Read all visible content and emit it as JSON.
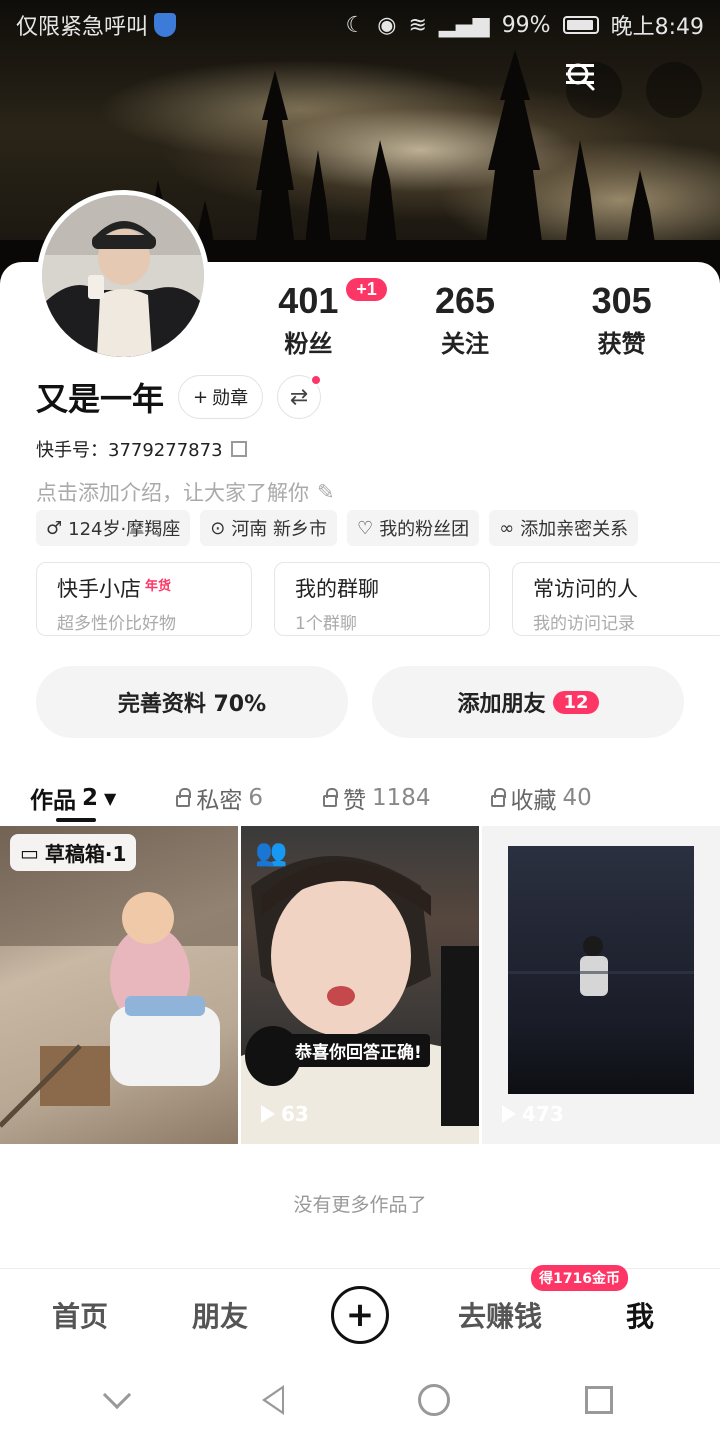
{
  "status_bar": {
    "left_text": "仅限紧急呼叫",
    "battery": "99%",
    "time": "晚上8:49"
  },
  "profile": {
    "stats": [
      {
        "value": "401",
        "label": "粉丝",
        "badge": "+1"
      },
      {
        "value": "265",
        "label": "关注"
      },
      {
        "value": "305",
        "label": "获赞"
      }
    ],
    "name": "又是一年",
    "medal_label": "勋章",
    "kwai_id": "快手号：3779277873",
    "bio_placeholder": "点击添加介绍，让大家了解你",
    "tags": [
      {
        "icon": "male-icon",
        "text": "124岁·摩羯座"
      },
      {
        "icon": "location-icon",
        "text": "河南 新乡市"
      },
      {
        "icon": "fan-club-icon",
        "text": "我的粉丝团"
      },
      {
        "icon": "intimate-icon",
        "text": "添加亲密关系"
      }
    ]
  },
  "features": [
    {
      "title": "快手小店",
      "badge": "年货",
      "subtitle": "超多性价比好物"
    },
    {
      "title": "我的群聊",
      "subtitle": "1个群聊"
    },
    {
      "title": "常访问的人",
      "subtitle": "我的访问记录"
    }
  ],
  "actions": {
    "complete_profile": "完善资料 70%",
    "add_friend": "添加朋友",
    "add_friend_count": "12"
  },
  "tabs": [
    {
      "label": "作品",
      "count": "2",
      "locked": false
    },
    {
      "label": "私密",
      "count": "6",
      "locked": true
    },
    {
      "label": "赞",
      "count": "1184",
      "locked": true
    },
    {
      "label": "收藏",
      "count": "40",
      "locked": true
    }
  ],
  "videos": [
    {
      "overlay": "草稿箱·1"
    },
    {
      "play_count": "63",
      "caption": "恭喜你回答正确!"
    },
    {
      "play_count": "473"
    }
  ],
  "no_more_text": "没有更多作品了",
  "bottom_nav": {
    "home": "首页",
    "friends": "朋友",
    "earn": "去赚钱",
    "earn_badge": "得1716金币",
    "me": "我"
  },
  "colors": {
    "accent": "#fe3666",
    "background": "#ffffff"
  }
}
